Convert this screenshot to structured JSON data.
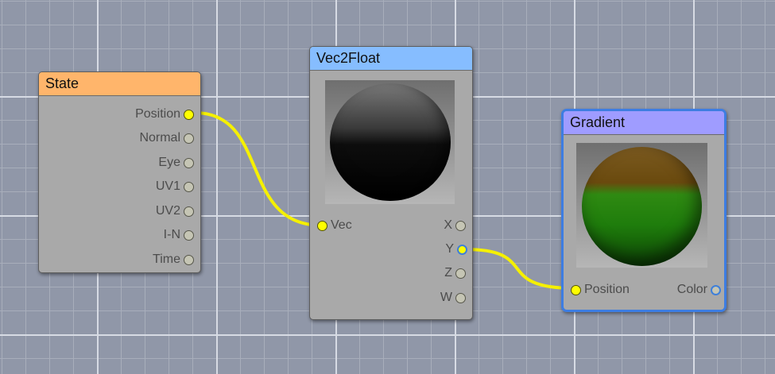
{
  "nodes": {
    "state": {
      "title": "State",
      "title_color": "#ffb56b",
      "outputs": [
        "Position",
        "Normal",
        "Eye",
        "UV1",
        "UV2",
        "I-N",
        "Time"
      ]
    },
    "vec2float": {
      "title": "Vec2Float",
      "title_color": "#86bdff",
      "input": "Vec",
      "outputs": [
        "X",
        "Y",
        "Z",
        "W"
      ]
    },
    "gradient": {
      "title": "Gradient",
      "title_color": "#9f9cff",
      "input": "Position",
      "output": "Color"
    }
  },
  "colors": {
    "wire": "#f5f000",
    "selection": "#3d7de2",
    "grid_background": "#9097a8"
  }
}
